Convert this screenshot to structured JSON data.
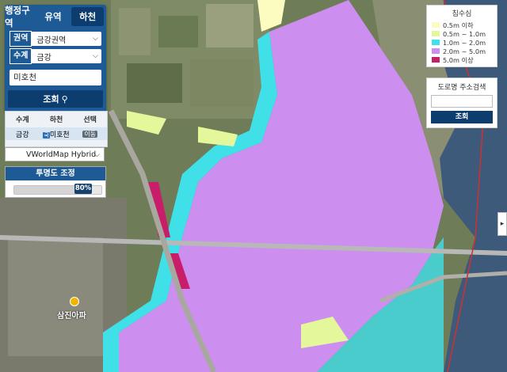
{
  "panel": {
    "tabs": [
      {
        "label": "행정구역",
        "active": false
      },
      {
        "label": "유역",
        "active": false
      },
      {
        "label": "하천",
        "active": true
      }
    ],
    "basin_label": "권역",
    "basin_value": "금강권역",
    "system_label": "수계",
    "system_value": "금강",
    "river_name": "미호천",
    "search_button": "조회"
  },
  "result": {
    "headers": [
      "수계",
      "하천",
      "선택"
    ],
    "row": {
      "system": "금강",
      "badge": "국",
      "river": "미호천",
      "action": "이동"
    }
  },
  "basemap": {
    "selected": "VWorldMap Hybrid"
  },
  "transparency": {
    "title": "투명도 조정",
    "value_label": "80%",
    "value": 0.8
  },
  "legend": {
    "title": "침수심",
    "items": [
      {
        "label": "0.5m 이하",
        "color": "#fdfcc0"
      },
      {
        "label": "0.5m ~ 1.0m",
        "color": "#e4f79b"
      },
      {
        "label": "1.0m ~ 2.0m",
        "color": "#40e0e8"
      },
      {
        "label": "2.0m ~ 5.0m",
        "color": "#cc8ff0"
      },
      {
        "label": "5.0m 이상",
        "color": "#c81e6a"
      }
    ]
  },
  "address_search": {
    "title": "도로명 주소검색",
    "button": "조회"
  },
  "map": {
    "poi": "삼진아파",
    "road_label": ""
  }
}
